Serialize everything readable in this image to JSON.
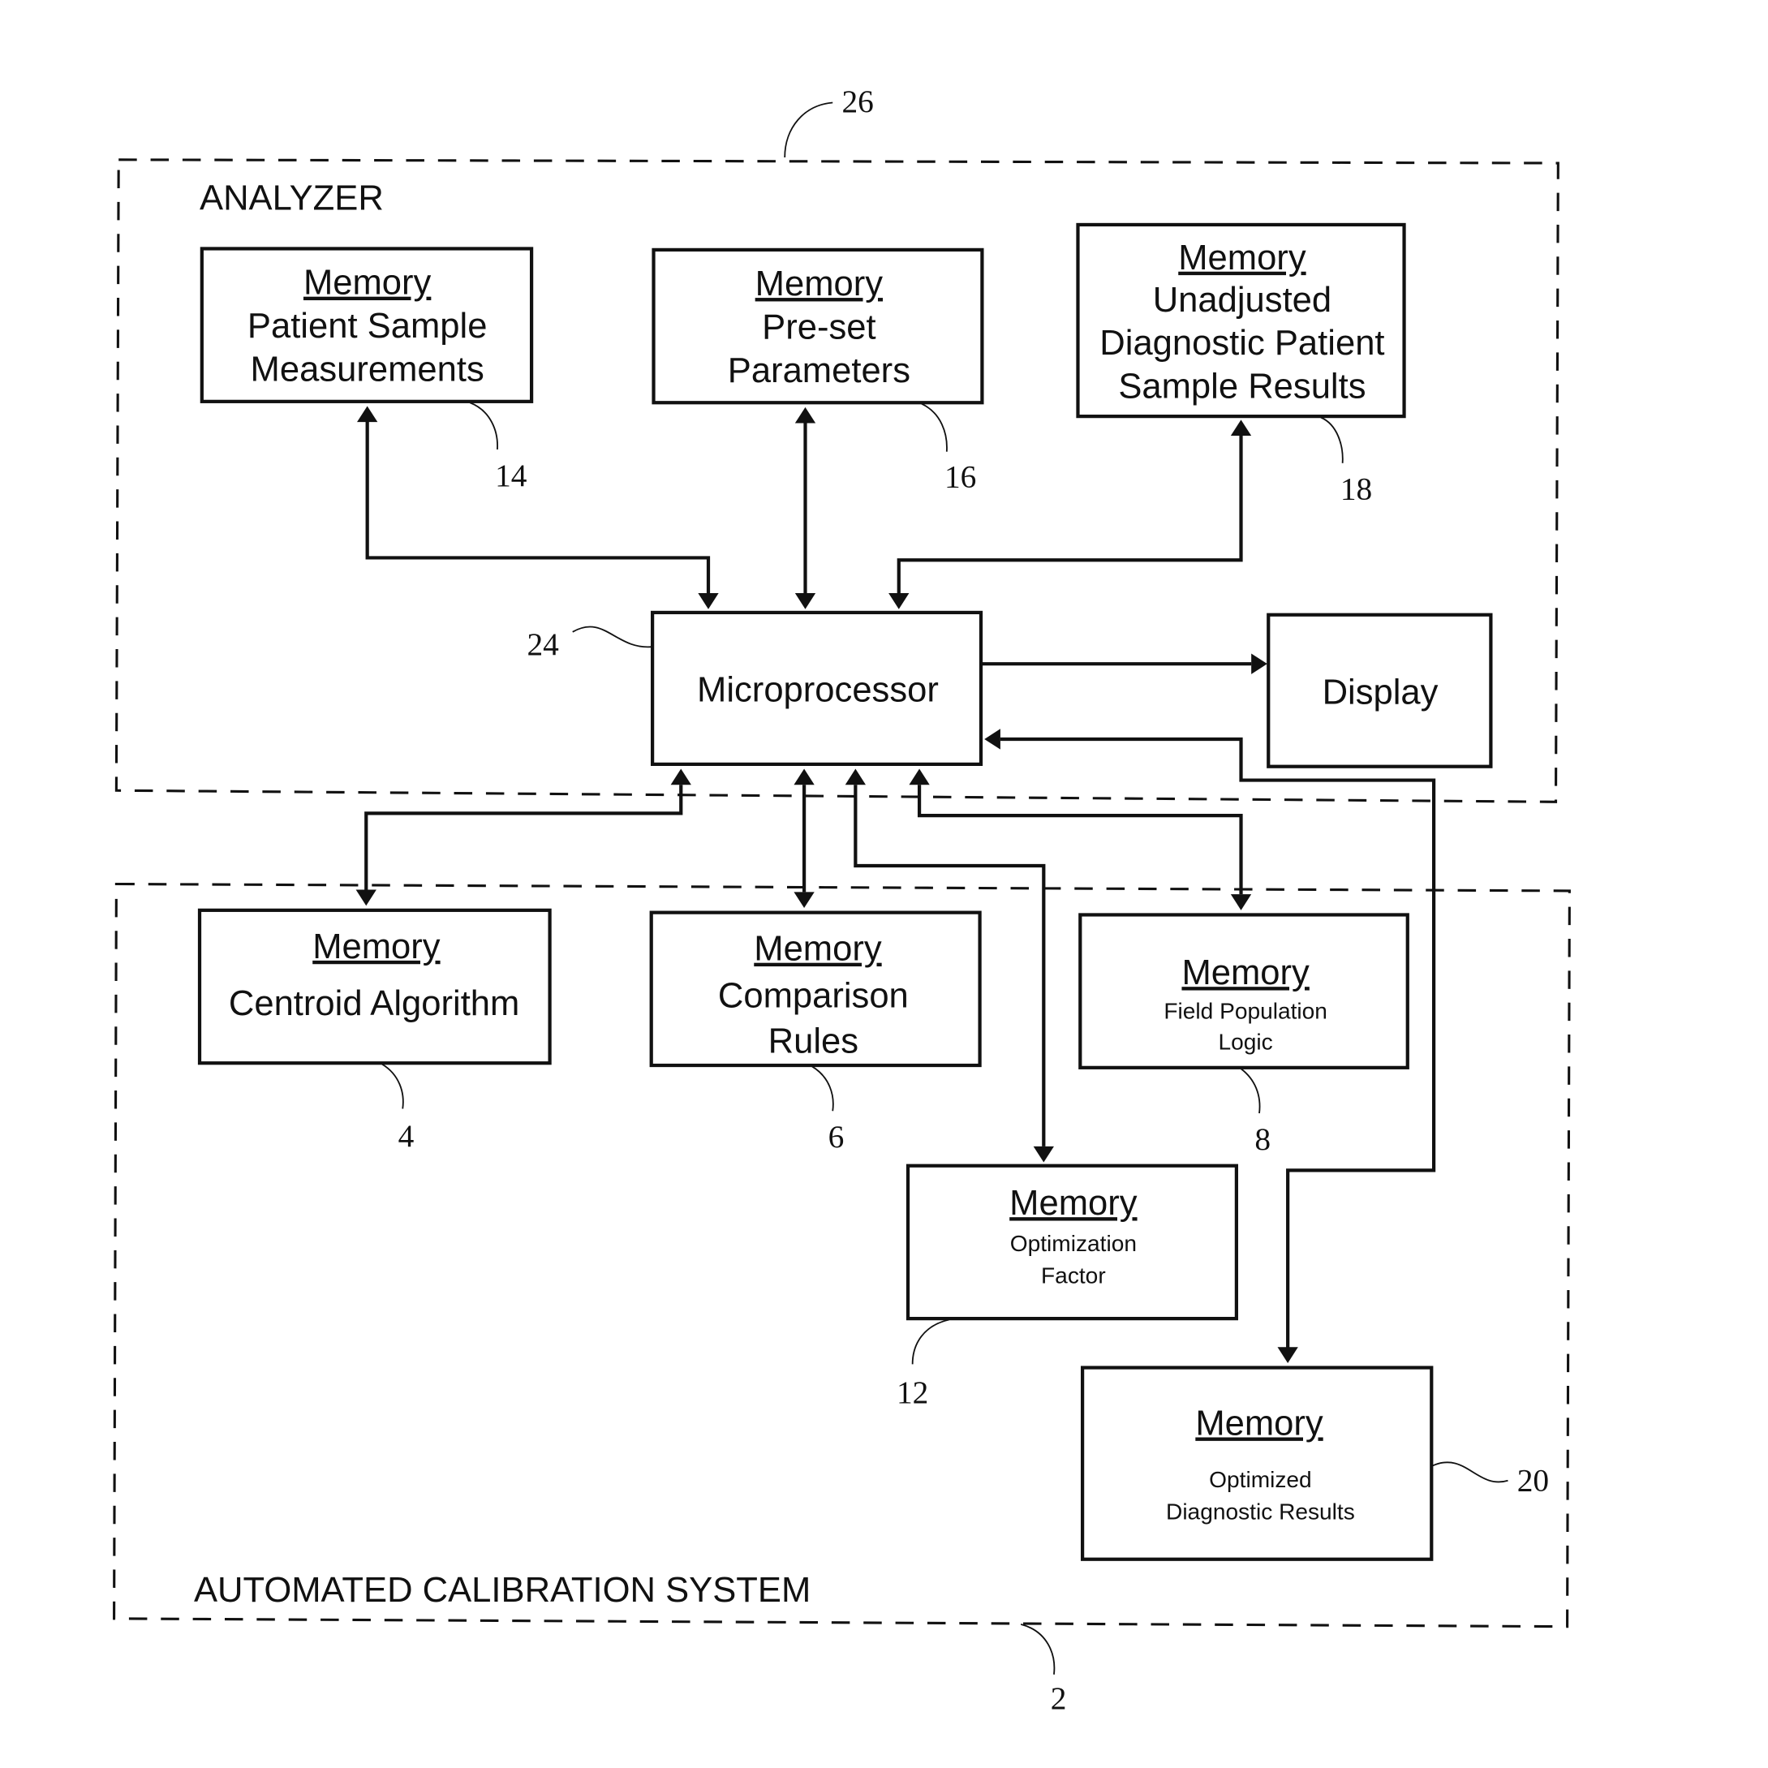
{
  "regions": {
    "analyzer": {
      "label": "ANALYZER",
      "ref": "26"
    },
    "calibration": {
      "label": "AUTOMATED CALIBRATION SYSTEM",
      "ref": "2"
    }
  },
  "blocks": {
    "patient_sample_measurements": {
      "title": "Memory",
      "lines": [
        "Patient Sample",
        "Measurements"
      ],
      "ref": "14"
    },
    "preset_parameters": {
      "title": "Memory",
      "lines": [
        "Pre-set",
        "Parameters"
      ],
      "ref": "16"
    },
    "unadjusted_results": {
      "title": "Memory",
      "lines": [
        "Unadjusted",
        "Diagnostic Patient",
        "Sample Results"
      ],
      "ref": "18"
    },
    "microprocessor": {
      "label": "Microprocessor",
      "ref": "24"
    },
    "display": {
      "label": "Display"
    },
    "centroid_algorithm": {
      "title": "Memory",
      "lines": [
        "Centroid Algorithm"
      ],
      "ref": "4"
    },
    "comparison_rules": {
      "title": "Memory",
      "lines": [
        "Comparison",
        "Rules"
      ],
      "ref": "6"
    },
    "field_population_logic": {
      "title": "Memory",
      "lines": [
        "Field Population",
        "Logic"
      ],
      "ref": "8"
    },
    "optimization_factor": {
      "title": "Memory",
      "lines": [
        "Optimization",
        "Factor"
      ],
      "ref": "12"
    },
    "optimized_results": {
      "title": "Memory",
      "lines": [
        "Optimized",
        "Diagnostic Results"
      ],
      "ref": "20"
    }
  }
}
